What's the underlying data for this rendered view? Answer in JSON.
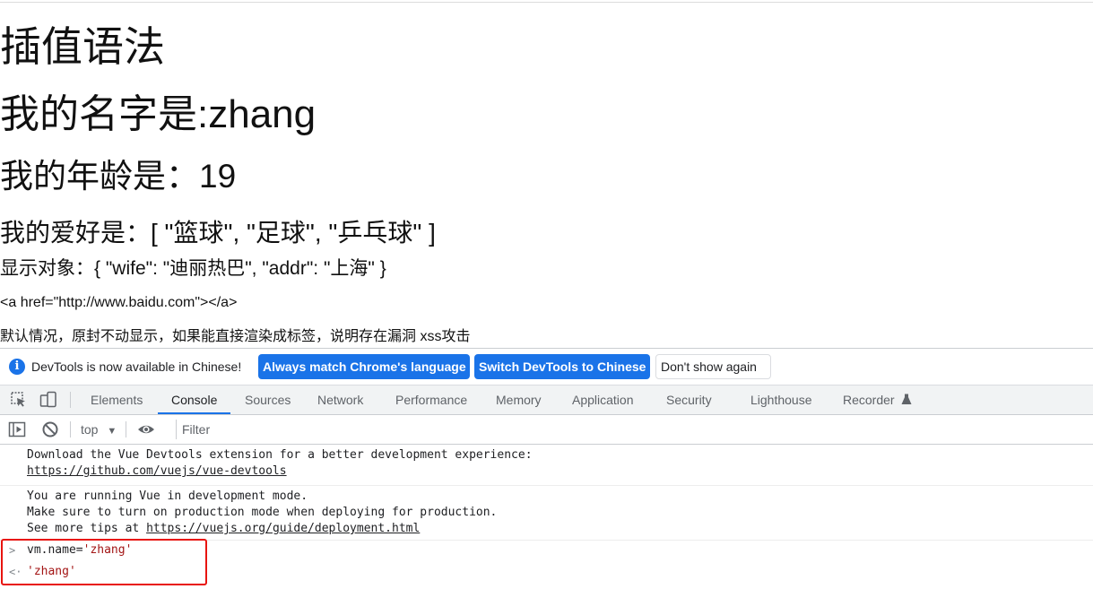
{
  "page": {
    "title": "插值语法",
    "name_line": "我的名字是:zhang",
    "age_line": "我的年龄是：19",
    "hobby_line": "我的爱好是：[ \"篮球\", \"足球\", \"乒乓球\" ]",
    "object_line": "显示对象：{ \"wife\": \"迪丽热巴\", \"addr\": \"上海\" }",
    "raw_html_line": "<a href=\"http://www.baidu.com\"></a>",
    "note_line": "默认情况，原封不动显示，如果能直接渲染成标签，说明存在漏洞 xss攻击"
  },
  "devtools": {
    "infobar": {
      "message": "DevTools is now available in Chinese!",
      "btn_match": "Always match Chrome's language",
      "btn_switch": "Switch DevTools to Chinese",
      "btn_dismiss": "Don't show again"
    },
    "tabs": [
      "Elements",
      "Console",
      "Sources",
      "Network",
      "Performance",
      "Memory",
      "Application",
      "Security",
      "Lighthouse",
      "Recorder"
    ],
    "active_tab": "Console",
    "context": "top",
    "filter_placeholder": "Filter",
    "console": {
      "msg1_line1": "Download the Vue Devtools extension for a better development experience:",
      "msg1_link": "https://github.com/vuejs/vue-devtools",
      "msg2_line1": "You are running Vue in development mode.",
      "msg2_line2": "Make sure to turn on production mode when deploying for production.",
      "msg2_line3_prefix": "See more tips at ",
      "msg2_link": "https://vuejs.org/guide/deployment.html",
      "input_prefix": "vm.name=",
      "input_value": "'zhang'",
      "result_value": "'zhang'"
    },
    "colors": {
      "accent": "#1a73e8",
      "highlight": "#e8140f",
      "string": "#a31515"
    }
  }
}
